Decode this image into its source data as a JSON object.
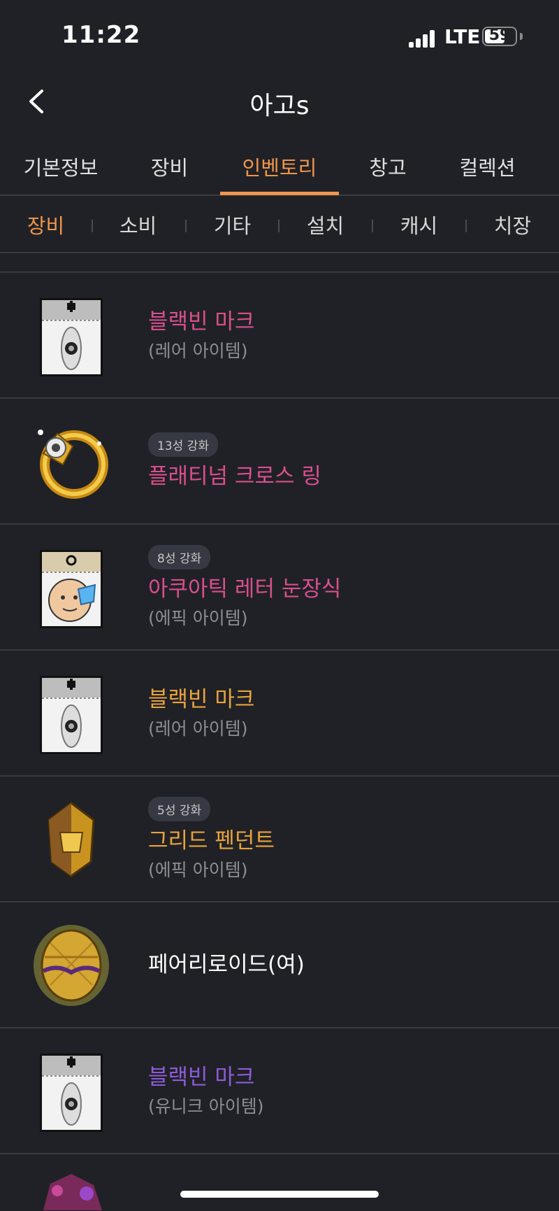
{
  "status": {
    "time": "11:22",
    "network": "LTE",
    "battery": "59"
  },
  "header": {
    "title": "아고s"
  },
  "main_tabs": [
    {
      "label": "기본정보"
    },
    {
      "label": "장비"
    },
    {
      "label": "인벤토리"
    },
    {
      "label": "창고"
    },
    {
      "label": "컬렉션"
    }
  ],
  "sub_tabs": [
    {
      "label": "장비"
    },
    {
      "label": "소비"
    },
    {
      "label": "기타"
    },
    {
      "label": "설치"
    },
    {
      "label": "캐시"
    },
    {
      "label": "치장"
    }
  ],
  "colors": {
    "accent": "#f0954a",
    "rare": "#d9508a",
    "epic": "#e8a33d",
    "unique": "#8d5bd9",
    "normal": "#ffffff"
  },
  "items": [
    {
      "icon": "black-bean-mark-icon",
      "badge": "",
      "name": "블랙빈 마크",
      "rarity": "(레어 아이템)",
      "name_color": "#d9508a"
    },
    {
      "icon": "platinum-cross-ring-icon",
      "badge": "13성 강화",
      "name": "플래티넘 크로스 링",
      "rarity": "",
      "name_color": "#d9508a"
    },
    {
      "icon": "aquatic-letter-eye-accessory-icon",
      "badge": "8성 강화",
      "name": "아쿠아틱 레터 눈장식",
      "rarity": "(에픽 아이템)",
      "name_color": "#d9508a"
    },
    {
      "icon": "black-bean-mark-icon",
      "badge": "",
      "name": "블랙빈 마크",
      "rarity": "(레어 아이템)",
      "name_color": "#e8a33d"
    },
    {
      "icon": "greed-pendant-icon",
      "badge": "5성 강화",
      "name": "그리드 펜던트",
      "rarity": "(에픽 아이템)",
      "name_color": "#e8a33d"
    },
    {
      "icon": "fairy-lloyd-egg-icon",
      "badge": "",
      "name": "페어리로이드(여)",
      "rarity": "",
      "name_color": "#ffffff"
    },
    {
      "icon": "black-bean-mark-icon",
      "badge": "",
      "name": "블랙빈 마크",
      "rarity": "(유니크 아이템)",
      "name_color": "#8d5bd9"
    }
  ]
}
